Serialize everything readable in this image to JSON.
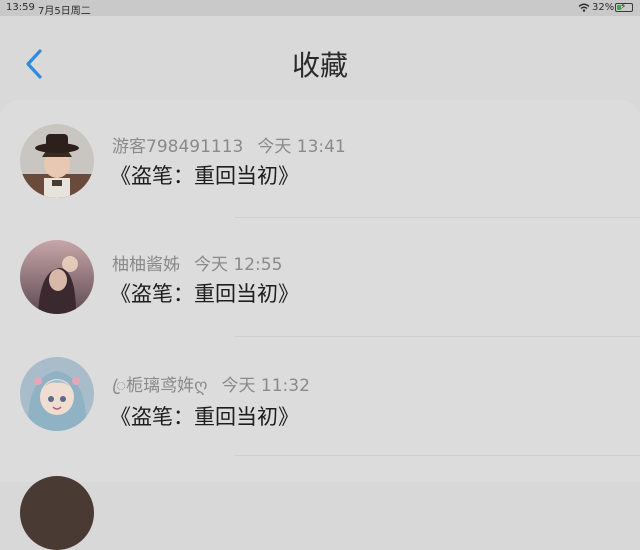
{
  "status_bar": {
    "time": "13:59",
    "date": "7月5日周二",
    "battery": "32%",
    "battery_level": 0.32,
    "icons": [
      "wifi-icon",
      "battery-icon",
      "charging-bolt-icon"
    ]
  },
  "header": {
    "title": "收藏",
    "back_icon": "chevron-left-icon",
    "accent_color": "#2f8be0"
  },
  "favorites": [
    {
      "user": "游客798491113",
      "time": "今天 13:41",
      "text": "《盗笔：重回当初》",
      "avatar": "avatar-boy-hat"
    },
    {
      "user": "柚柚酱姊",
      "time": "今天 12:55",
      "text": "《盗笔：重回当初》",
      "avatar": "avatar-girl-sunset"
    },
    {
      "user": "ꦿ栀璃鸢姩ღ",
      "time": "今天 11:32",
      "text": "《盗笔：重回当初》",
      "avatar": "avatar-anime-girl"
    }
  ]
}
